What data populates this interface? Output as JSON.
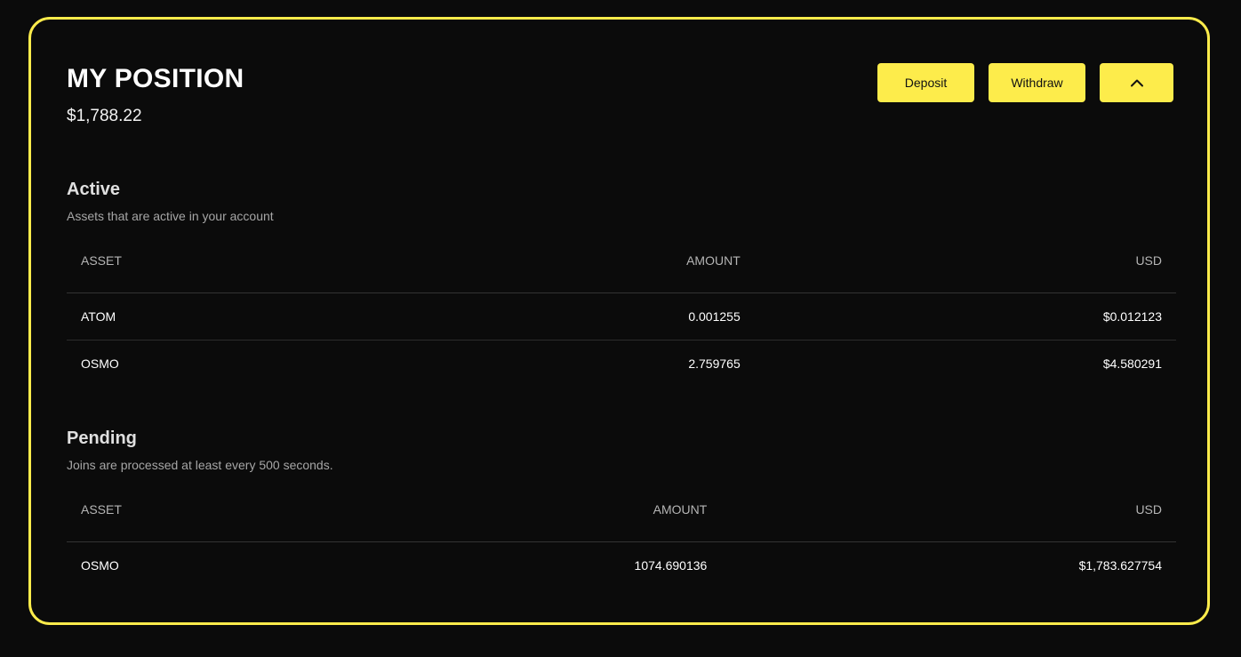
{
  "position": {
    "title": "MY POSITION",
    "total": "$1,788.22"
  },
  "actions": {
    "deposit_label": "Deposit",
    "withdraw_label": "Withdraw",
    "collapse_icon": "chevron-up-icon"
  },
  "active": {
    "title": "Active",
    "subtitle": "Assets that are active in your account",
    "columns": [
      "ASSET",
      "AMOUNT",
      "USD"
    ],
    "rows": [
      {
        "asset": "ATOM",
        "amount": "0.001255",
        "usd": "$0.012123"
      },
      {
        "asset": "OSMO",
        "amount": "2.759765",
        "usd": "$4.580291"
      }
    ]
  },
  "pending": {
    "title": "Pending",
    "subtitle": "Joins are processed at least every 500 seconds.",
    "columns": [
      "ASSET",
      "AMOUNT",
      "USD"
    ],
    "rows": [
      {
        "asset": "OSMO",
        "amount": "1074.690136",
        "usd": "$1,783.627754"
      }
    ]
  },
  "colors": {
    "accent": "#fdec4b",
    "background": "#0b0b0b"
  }
}
